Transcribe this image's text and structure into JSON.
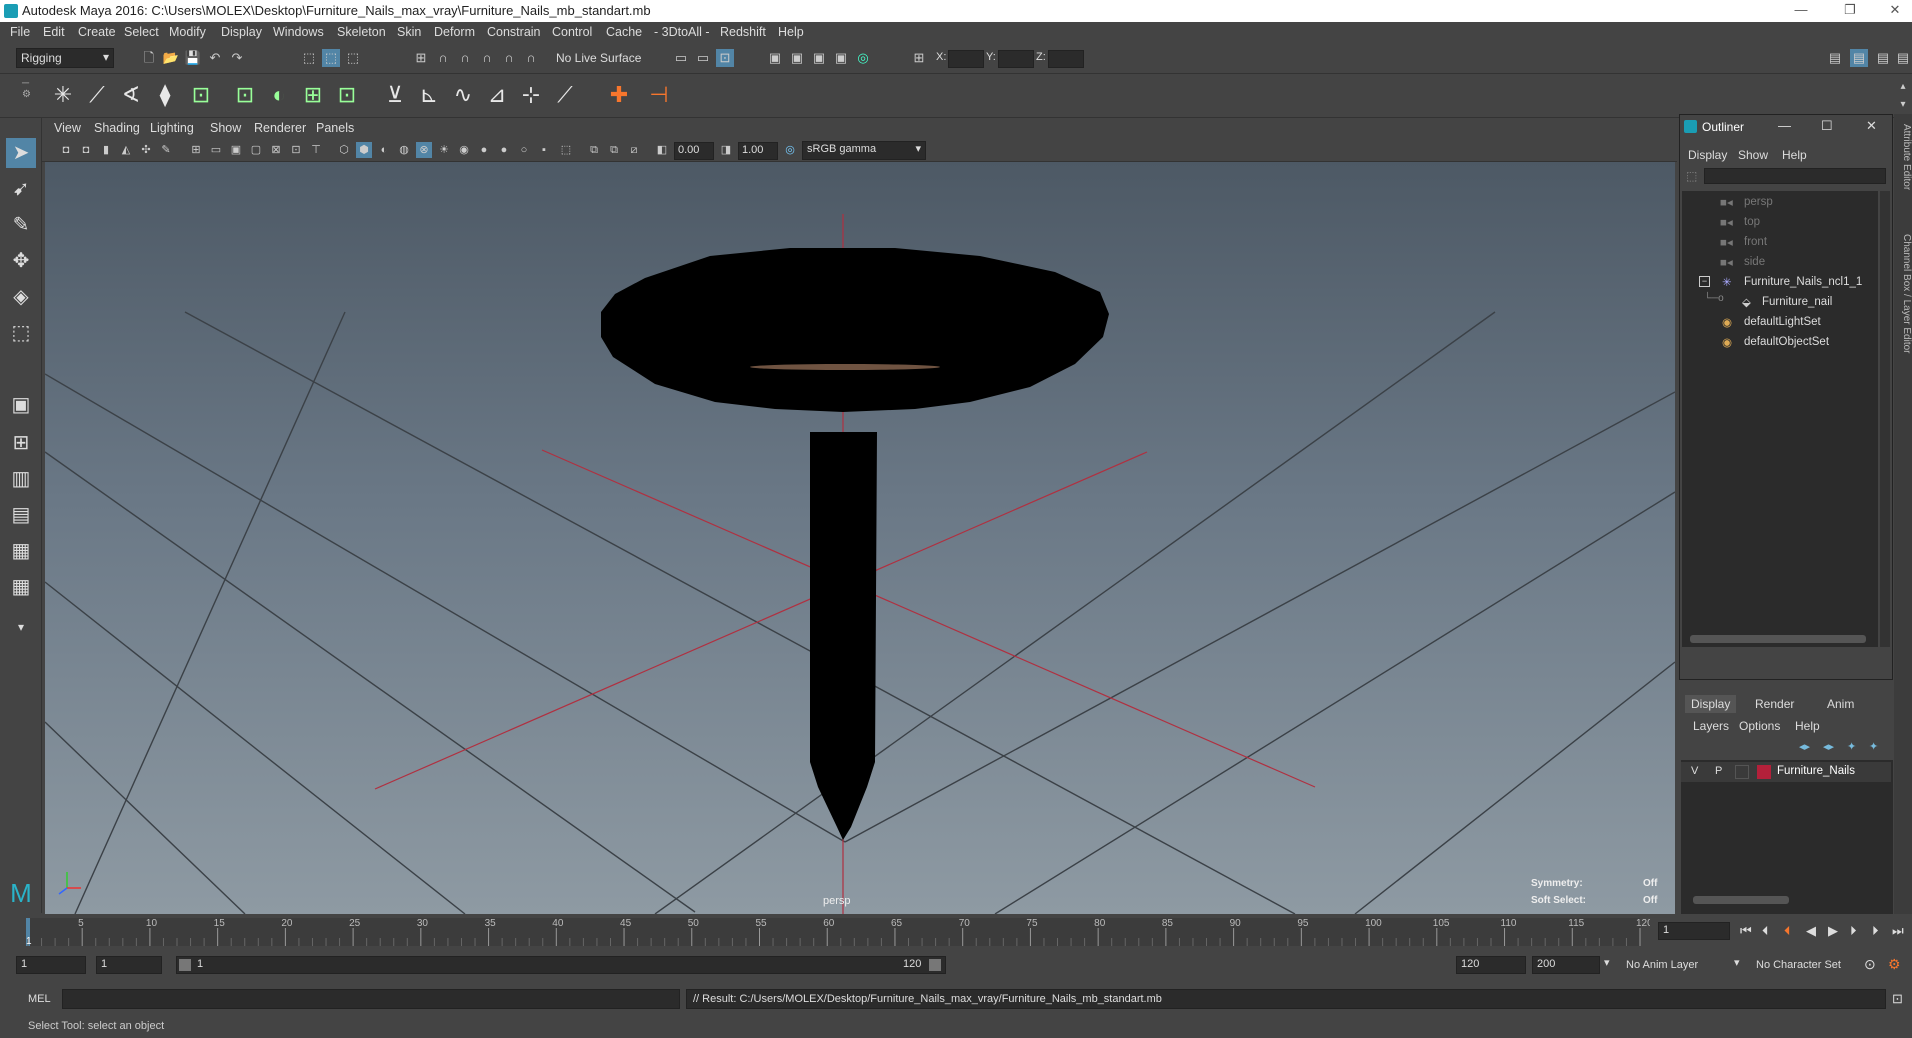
{
  "window": {
    "title": "Autodesk Maya 2016: C:\\Users\\MOLEX\\Desktop\\Furniture_Nails_max_vray\\Furniture_Nails_mb_standart.mb",
    "minimize": "—",
    "restore": "❐",
    "close": "✕"
  },
  "menubar": [
    "File",
    "Edit",
    "Create",
    "Select",
    "Modify",
    "Display",
    "Windows",
    "Skeleton",
    "Skin",
    "Deform",
    "Constrain",
    "Control",
    "Cache",
    "- 3DtoAll -",
    "Redshift",
    "Help"
  ],
  "statusline": {
    "menuset": "Rigging",
    "live_surface": "No Live Surface",
    "x_label": "X:",
    "y_label": "Y:",
    "z_label": "Z:"
  },
  "viewport_menu": [
    "View",
    "Shading",
    "Lighting",
    "Show",
    "Renderer",
    "Panels"
  ],
  "viewport_toolbar": {
    "exposure": "0.00",
    "gamma": "1.00",
    "colorspace": "sRGB gamma"
  },
  "viewport": {
    "camera_label": "persp",
    "symmetry_label": "Symmetry:",
    "symmetry_value": "Off",
    "soft_select_label": "Soft Select:",
    "soft_select_value": "Off"
  },
  "outliner": {
    "title": "Outliner",
    "menu": [
      "Display",
      "Show",
      "Help"
    ],
    "items": [
      {
        "label": "persp",
        "icon": "camera-icon",
        "dim": true
      },
      {
        "label": "top",
        "icon": "camera-icon",
        "dim": true
      },
      {
        "label": "front",
        "icon": "camera-icon",
        "dim": true
      },
      {
        "label": "side",
        "icon": "camera-icon",
        "dim": true
      },
      {
        "label": "Furniture_Nails_ncl1_1",
        "icon": "group-icon",
        "dim": false
      },
      {
        "label": "Furniture_nail",
        "icon": "mesh-icon",
        "dim": false
      },
      {
        "label": "defaultLightSet",
        "icon": "set-icon",
        "dim": false
      },
      {
        "label": "defaultObjectSet",
        "icon": "set-icon",
        "dim": false
      }
    ]
  },
  "right_tabs": [
    "Attribute Editor",
    "Channel Box / Layer Editor"
  ],
  "layer_editor": {
    "tabs": [
      "Display",
      "Render",
      "Anim"
    ],
    "menu": [
      "Layers",
      "Options",
      "Help"
    ],
    "layer": {
      "v": "V",
      "p": "P",
      "name": "Furniture_Nails",
      "color": "#b3203a"
    }
  },
  "timeline": {
    "ticks": [
      "5",
      "10",
      "15",
      "20",
      "25",
      "30",
      "35",
      "40",
      "45",
      "50",
      "55",
      "60",
      "65",
      "70",
      "75",
      "80",
      "85",
      "90",
      "95",
      "100",
      "105",
      "110",
      "115",
      "120"
    ],
    "start_marker": "1",
    "current_frame": "1"
  },
  "range": {
    "start": "1",
    "playback_start": "1",
    "slider_start": "1",
    "slider_end": "120",
    "playback_end": "120",
    "end": "200",
    "anim_layer": "No Anim Layer",
    "character_set": "No Character Set"
  },
  "command": {
    "mel_label": "MEL",
    "result": "// Result: C:/Users/MOLEX/Desktop/Furniture_Nails_max_vray/Furniture_Nails_mb_standart.mb"
  },
  "helpline": "Select Tool: select an object",
  "colors": {
    "accent": "#5285a6",
    "layer_red": "#b3203a",
    "axis_red": "#b03040"
  }
}
